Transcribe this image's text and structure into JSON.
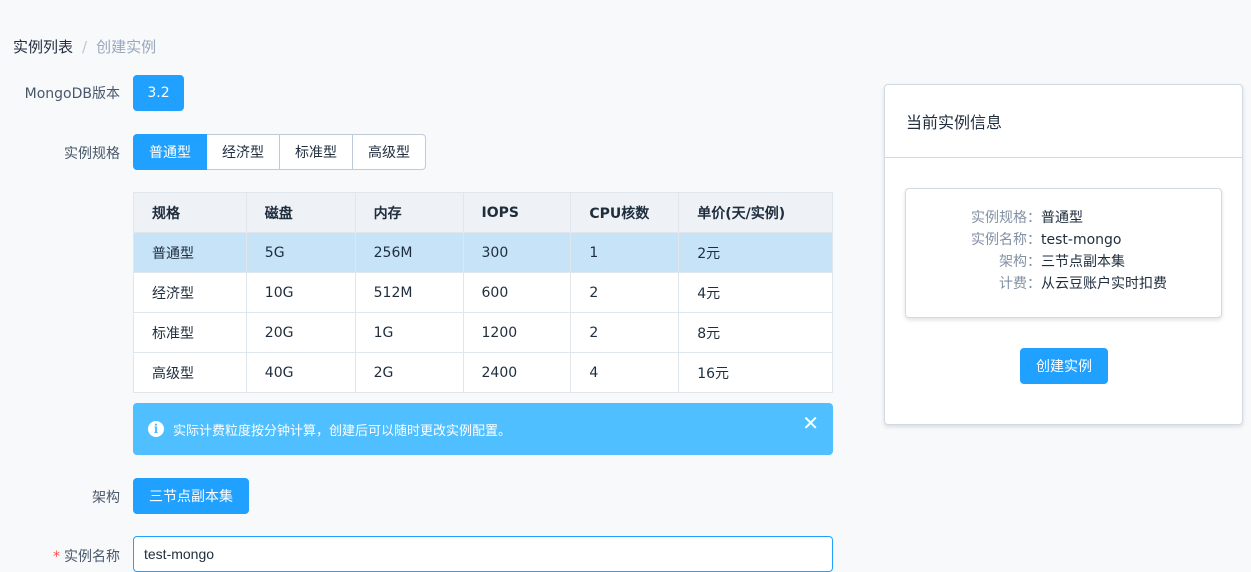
{
  "breadcrumb": {
    "parent": "实例列表",
    "separator": "/",
    "current": "创建实例"
  },
  "form": {
    "version_label": "MongoDB版本",
    "version_value": "3.2",
    "spec_label": "实例规格",
    "spec_options": [
      "普通型",
      "经济型",
      "标准型",
      "高级型"
    ],
    "spec_selected": "普通型",
    "arch_label": "架构",
    "arch_value": "三节点副本集",
    "name_label": "实例名称",
    "name_required_mark": "*",
    "name_value": "test-mongo"
  },
  "table": {
    "headers": [
      "规格",
      "磁盘",
      "内存",
      "IOPS",
      "CPU核数",
      "单价(天/实例)"
    ],
    "rows": [
      [
        "普通型",
        "5G",
        "256M",
        "300",
        "1",
        "2元"
      ],
      [
        "经济型",
        "10G",
        "512M",
        "600",
        "2",
        "4元"
      ],
      [
        "标准型",
        "20G",
        "1G",
        "1200",
        "2",
        "8元"
      ],
      [
        "高级型",
        "40G",
        "2G",
        "2400",
        "4",
        "16元"
      ]
    ]
  },
  "alert": {
    "text": "实际计费粒度按分钟计算，创建后可以随时更改实例配置。",
    "icon": "info-icon",
    "close": "✕"
  },
  "summary": {
    "title": "当前实例信息",
    "items": [
      {
        "key": "实例规格：",
        "value": "普通型"
      },
      {
        "key": "实例名称：",
        "value": "test-mongo"
      },
      {
        "key": "架构：",
        "value": "三节点副本集"
      },
      {
        "key": "计费：",
        "value": "从云豆账户实时扣费"
      }
    ],
    "create_button": "创建实例"
  },
  "colors": {
    "primary": "#20a0ff",
    "alert": "#50bfff",
    "selected_row": "#c7e3f7"
  }
}
